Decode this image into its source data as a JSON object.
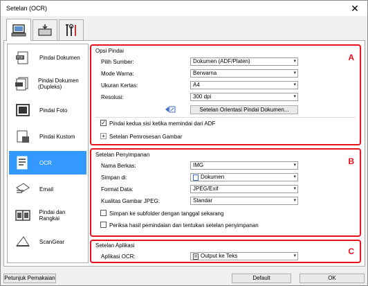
{
  "window": {
    "title": "Setelan (OCR)",
    "close": "✕"
  },
  "tabs": [
    {
      "name": "tab-scan-from-computer",
      "icon": "computer-scan-icon"
    },
    {
      "name": "tab-scan-from-panel",
      "icon": "device-scan-icon"
    },
    {
      "name": "tab-general-settings",
      "icon": "tools-icon"
    }
  ],
  "sidebar": {
    "items": [
      {
        "label": "Pindai Dokumen",
        "icon": "pdf-document-icon"
      },
      {
        "label": "Pindai Dokumen (Dupleks)",
        "icon": "duplex-document-icon"
      },
      {
        "label": "Pindai Foto",
        "icon": "photo-icon"
      },
      {
        "label": "Pindai Kustom",
        "icon": "custom-scan-icon"
      },
      {
        "label": "OCR",
        "icon": "ocr-icon",
        "selected": true
      },
      {
        "label": "Email",
        "icon": "email-icon"
      },
      {
        "label": "Pindai dan Rangkai",
        "icon": "stitch-icon"
      },
      {
        "label": "ScanGear",
        "icon": "scangear-icon"
      }
    ]
  },
  "scan_options": {
    "title": "Opsi Pindai",
    "letter": "A",
    "source_label": "Pilih Sumber:",
    "source_value": "Dokumen (ADF/Platen)",
    "color_label": "Mode Warna:",
    "color_value": "Berwarna",
    "paper_label": "Ukuran Kertas:",
    "paper_value": "A4",
    "resolution_label": "Resolusi:",
    "resolution_value": "300 dpi",
    "orientation_button": "Setelan Orientasi Pindai Dokumen...",
    "duplex_label": "Pindai kedua sisi ketika memindai dari ADF",
    "duplex_checked": true,
    "image_processing_label": "Setelan Pemrosesan Gambar"
  },
  "save_settings": {
    "title": "Setelan Penyimpanan",
    "letter": "B",
    "filename_label": "Nama Berkas:",
    "filename_value": "IMG",
    "savein_label": "Simpan di:",
    "savein_value": "Dokumen",
    "format_label": "Format Data:",
    "format_value": "JPEG/Exif",
    "jpeg_label": "Kualitas Gambar JPEG:",
    "jpeg_value": "Standar",
    "subfolder_label": "Simpan ke subfolder dengan tanggal sekarang",
    "subfolder_checked": false,
    "check_label": "Periksa hasil pemindaian dan tentukan setelan penyimpanan",
    "check_checked": false
  },
  "app_settings": {
    "title": "Setelan Aplikasi",
    "letter": "C",
    "ocr_label": "Aplikasi OCR:",
    "ocr_value": "Output ke Teks"
  },
  "footer": {
    "help": "Petunjuk Pemakaian",
    "defaults": "Default",
    "ok": "OK"
  }
}
